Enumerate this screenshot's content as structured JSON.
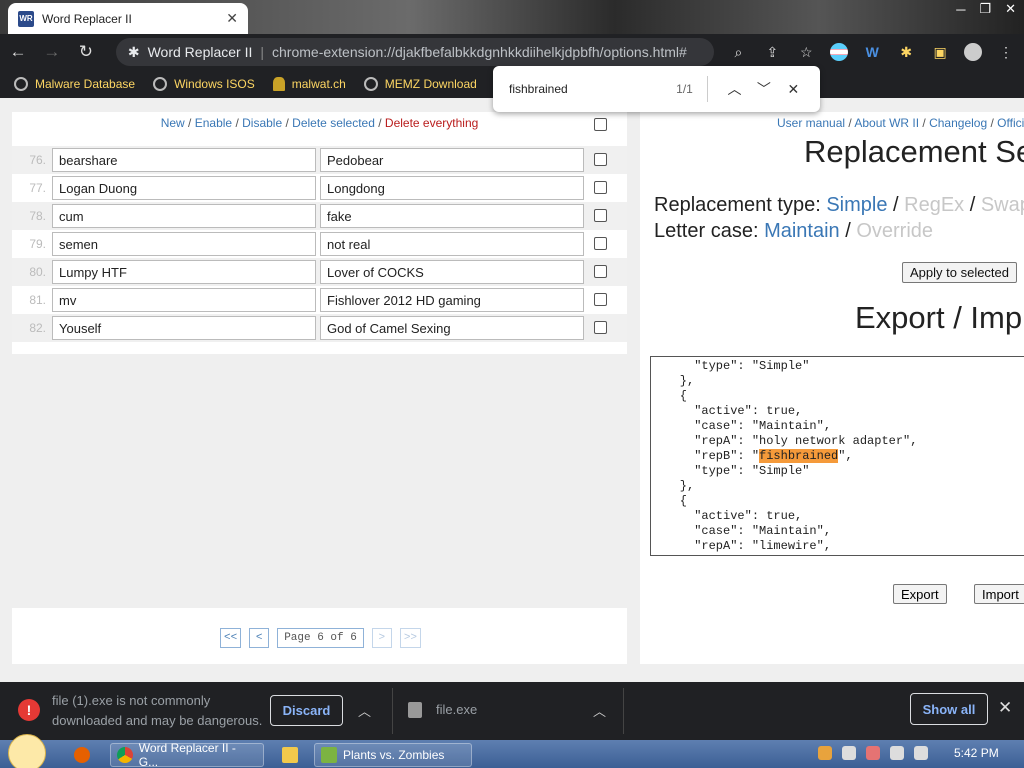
{
  "browser": {
    "tab_title": "Word Replacer II",
    "tab_favicon": "WR",
    "omnibox_title": "Word Replacer II",
    "omnibox_sep": "|",
    "url": "chrome-extension://djakfbefalbkkdgnhkkdiihelkjdpbfh/options.html#"
  },
  "bookmarks": [
    {
      "label": "Malware Database",
      "icon": "globe-icon"
    },
    {
      "label": "Windows ISOS",
      "icon": "globe-icon"
    },
    {
      "label": "malwat.ch",
      "icon": "fig-icon"
    },
    {
      "label": "MEMZ Download",
      "icon": "globe-icon"
    }
  ],
  "find": {
    "query": "fishbrained",
    "count": "1/1"
  },
  "list": {
    "actions": {
      "new": "New",
      "enable": "Enable",
      "disable": "Disable",
      "delete_selected": "Delete selected",
      "delete_everything": "Delete everything",
      "sep": " / "
    },
    "rows": [
      {
        "num": "76.",
        "from": "bearshare",
        "to": "Pedobear"
      },
      {
        "num": "77.",
        "from": "Logan Duong",
        "to": "Longdong"
      },
      {
        "num": "78.",
        "from": "cum",
        "to": "fake"
      },
      {
        "num": "79.",
        "from": "semen",
        "to": "not real"
      },
      {
        "num": "80.",
        "from": "Lumpy HTF",
        "to": "Lover of COCKS"
      },
      {
        "num": "81.",
        "from": "mv",
        "to": "Fishlover 2012 HD gaming"
      },
      {
        "num": "82.",
        "from": "Youself",
        "to": "God of Camel Sexing"
      }
    ]
  },
  "pager": {
    "first": "<<",
    "prev": "<",
    "page": "Page 6 of 6",
    "next": ">",
    "last": ">>"
  },
  "right": {
    "links": {
      "user_manual": "User manual",
      "about": "About WR II",
      "changelog": "Changelog",
      "official": "Offici",
      "sep": " / "
    },
    "title": "Replacement Se",
    "rep_type_label": "Replacement type: ",
    "rep_type_simple": "Simple",
    "rep_type_regex": "RegEx",
    "rep_type_swap": "Swap",
    "letter_case_label": "Letter case: ",
    "letter_case_maintain": "Maintain",
    "letter_case_override": "Override",
    "opt_sep": " / ",
    "apply_button": "Apply to selected",
    "export_title": "Export / Imp",
    "json_lines_before": "      \"type\": \"Simple\"\n    },\n    {\n      \"active\": true,\n      \"case\": \"Maintain\",\n      \"repA\": \"holy network adapter\",\n      \"repB\": \"",
    "json_highlight": "fishbrained",
    "json_lines_after": "\",\n      \"type\": \"Simple\"\n    },\n    {\n      \"active\": true,\n      \"case\": \"Maintain\",\n      \"repA\": \"limewire\",",
    "export_button": "Export",
    "import_button": "Import"
  },
  "download_bar": {
    "warning": "file (1).exe is not commonly downloaded and may be dangerous.",
    "discard": "Discard",
    "file_name": "file.exe",
    "show_all": "Show all"
  },
  "taskbar": {
    "apps": [
      {
        "label": "Word Replacer II - G...",
        "icon": "chrome-icon"
      },
      {
        "label": "Plants vs. Zombies",
        "icon": "game-icon"
      }
    ],
    "clock": "5:42 PM"
  },
  "colors": {
    "link": "#3a77b5",
    "danger": "#b91c1c",
    "highlight": "#f59a3a",
    "bookmark_text": "#fdd663"
  }
}
